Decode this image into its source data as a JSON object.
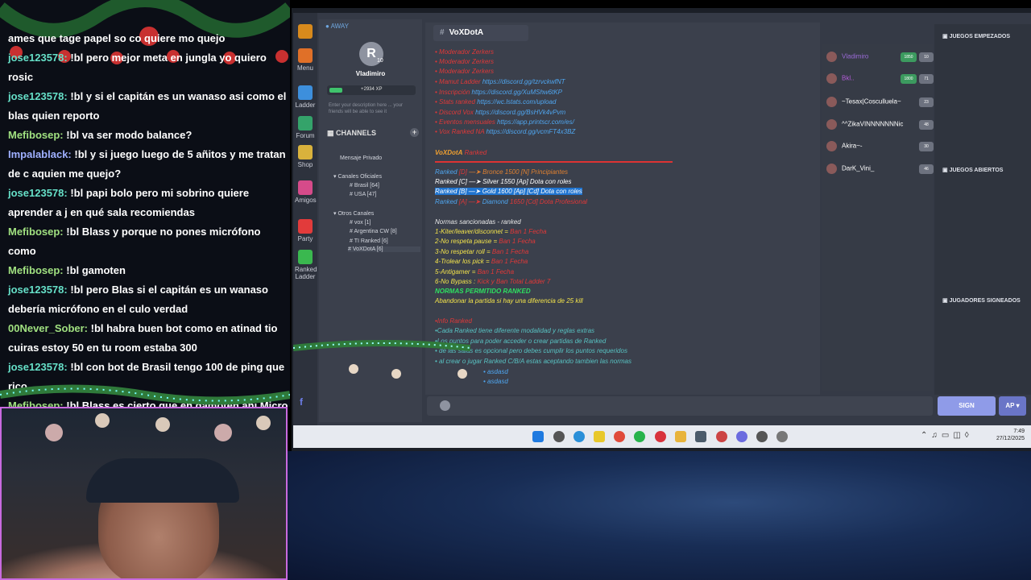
{
  "chat": {
    "partial_top": "ames que tage papel so co quiere mo quejo",
    "messages": [
      {
        "user": "jose123578:",
        "text": " !bl pero mejor meta en jungla yo quiero rosic"
      },
      {
        "user": "jose123578:",
        "text": " !bl y si el capitán es un wanaso asi como el blas quien reporto"
      },
      {
        "user": "Mefibosep:",
        "text": " !bl va ser modo balance?"
      },
      {
        "user": "Impalablack:",
        "text": " !bl y si juego luego de 5 añitos y me tratan de c aquien me quejo?"
      },
      {
        "user": "jose123578:",
        "text": " !bl papi bolo pero mi sobrino quiere aprender a j en qué sala recomiendas"
      },
      {
        "user": "Mefibosep:",
        "text": " !bl Blass y porque no pones micrófono como"
      },
      {
        "user": "Mefibosep:",
        "text": " !bl gamoten"
      },
      {
        "user": "jose123578:",
        "text": " !bl pero Blas si el capitán es un wanaso debería micrófono en el culo verdad"
      },
      {
        "user": "00Never_Sober:",
        "text": " !bl habra buen bot como en atinad tio cuiras estoy 50 en tu room estaba 300"
      },
      {
        "user": "jose123578:",
        "text": " !bl con bot de Brasil tengo 100 de ping que rico"
      },
      {
        "user": "Mefibosep:",
        "text": " !bl Blass es cierto que en gamoten ahi Micro por"
      }
    ]
  },
  "rail": {
    "menu": "Menu",
    "ladder": "Ladder",
    "forum": "Forum",
    "shop": "Shop",
    "amigos": "Amigos",
    "party": "Party",
    "ranked": "Ranked Ladder"
  },
  "profile": {
    "status": "AWAY",
    "level": "10",
    "name": "Vladimiro",
    "xp": "+2934 XP",
    "desc": "Enter your description here ... your friends will be able to see it"
  },
  "channels": {
    "header": "CHANNELS",
    "private": "Mensaje Privado",
    "oficiales": "Canales Oficiales",
    "brasil": "Brasil [64]",
    "usa": "USA [47]",
    "otros": "Otros Canales",
    "vox": "vox [1]",
    "argentina": "Argentina CW [8]",
    "ti": "TI Ranked [6]",
    "voxdota": "VoXDotA [6]"
  },
  "main": {
    "channel": "VoXDotA",
    "links": [
      {
        "pre": "• ",
        "name": "Moderador Zerkers",
        "url": ""
      },
      {
        "pre": "• ",
        "name": "Moderador Zerkers",
        "url": ""
      },
      {
        "pre": "• ",
        "name": "Moderador Zerkers",
        "url": ""
      },
      {
        "pre": "• ",
        "name": "Mamut Ladder",
        "url": "https://discord.gg/tzrvckwfNT"
      },
      {
        "pre": "• ",
        "name": "Inscripción",
        "url": "https://discord.gg/XuMShw6tKP"
      },
      {
        "pre": "• ",
        "name": "Stats ranked",
        "url": "https://wc.lstats.com/upload"
      },
      {
        "pre": "• ",
        "name": "Discord Vox",
        "url": "https://discord.gg/BsHVk4vPvm"
      },
      {
        "pre": "• ",
        "name": "Eventos mensuales",
        "url": "https://app.printscr.com/es/"
      },
      {
        "pre": "• ",
        "name": "Vox Ranked NA",
        "url": "https://discord.gg/vcmFT4x3BZ"
      }
    ],
    "voxdota_head": "VoXDotA",
    "voxdota_sub": "Ranked",
    "ranks": [
      {
        "a": "Ranked ",
        "b": "[D]",
        "c": " —➤ Bronce",
        "d": "   1500 [N] Principiantes"
      },
      {
        "a": "Ranked ",
        "b": "[C]",
        "c": " —➤ Silver",
        "d": "   1550 [Ap] Dota con roles"
      },
      {
        "a": "Ranked [B] —➤ Gold",
        "b": "",
        "c": "",
        "d": "   1600 [Ap] [Cd] Dota con roles"
      },
      {
        "a": "Ranked ",
        "b": "[A] —➤",
        "c": " Diamond",
        "d": "   1650  [Cd] Dota Profesional"
      }
    ],
    "rules_head": "Normas sancionadas - ranked",
    "rules": [
      {
        "t": "1-Kiter/leaver/disconnet = ",
        "p": "Ban 1 Fecha"
      },
      {
        "t": "2-No respeta pause = ",
        "p": "Ban 1 Fecha"
      },
      {
        "t": "3-No respetar roll = ",
        "p": "Ban 1 Fecha"
      },
      {
        "t": "4-Trolear los pick = ",
        "p": "Ban 1 Fecha"
      },
      {
        "t": "5-Antigamer = ",
        "p": "Ban 1 Fecha"
      },
      {
        "t": "6-No Bypass : ",
        "p": "Kick y Ban Total Ladder 7"
      }
    ],
    "norm_green": "NORMAS PERMITIDO RANKED",
    "norm_yellow": "Abandonar la partida si hay una diferencia de 25 kill",
    "info": [
      "•Info Ranked",
      "•Cada Ranked tiene diferente modalidad y reglas extras",
      "•Los puntos para poder acceder o crear partidas de Ranked",
      "• de las salas es opcional pero debes cumplir los puntos requeridos",
      "• al crear o jugar Ranked C/B/A estas aceptando tambien las normas",
      "• asdasd",
      "• asdasd"
    ]
  },
  "members": [
    {
      "name": "Vladimiro",
      "badge": "1850",
      "n": "10"
    },
    {
      "name": "Bkl..",
      "badge": "1800",
      "n": "71"
    },
    {
      "name": "~Tesax|Cosculluela~",
      "badge": "",
      "n": "23"
    },
    {
      "name": "^^ZikaVINNNNNNNic",
      "badge": "",
      "n": "48"
    },
    {
      "name": "Akira~-",
      "badge": "",
      "n": "30"
    },
    {
      "name": "DarK_Vini_",
      "badge": "",
      "n": "46"
    }
  ],
  "right": {
    "started": "JUEGOS EMPEZADOS",
    "open": "JUEGOS ABIERTOS",
    "signed": "JUGADORES SIGNEADOS",
    "sign": "SIGN",
    "ap": "AP"
  },
  "clock": {
    "time": "7:49",
    "date": "27/12/2025"
  },
  "colors": {
    "accent": "#8f9be8",
    "link": "#4fa6f0",
    "danger": "#e03838",
    "ok": "#2ee060"
  }
}
